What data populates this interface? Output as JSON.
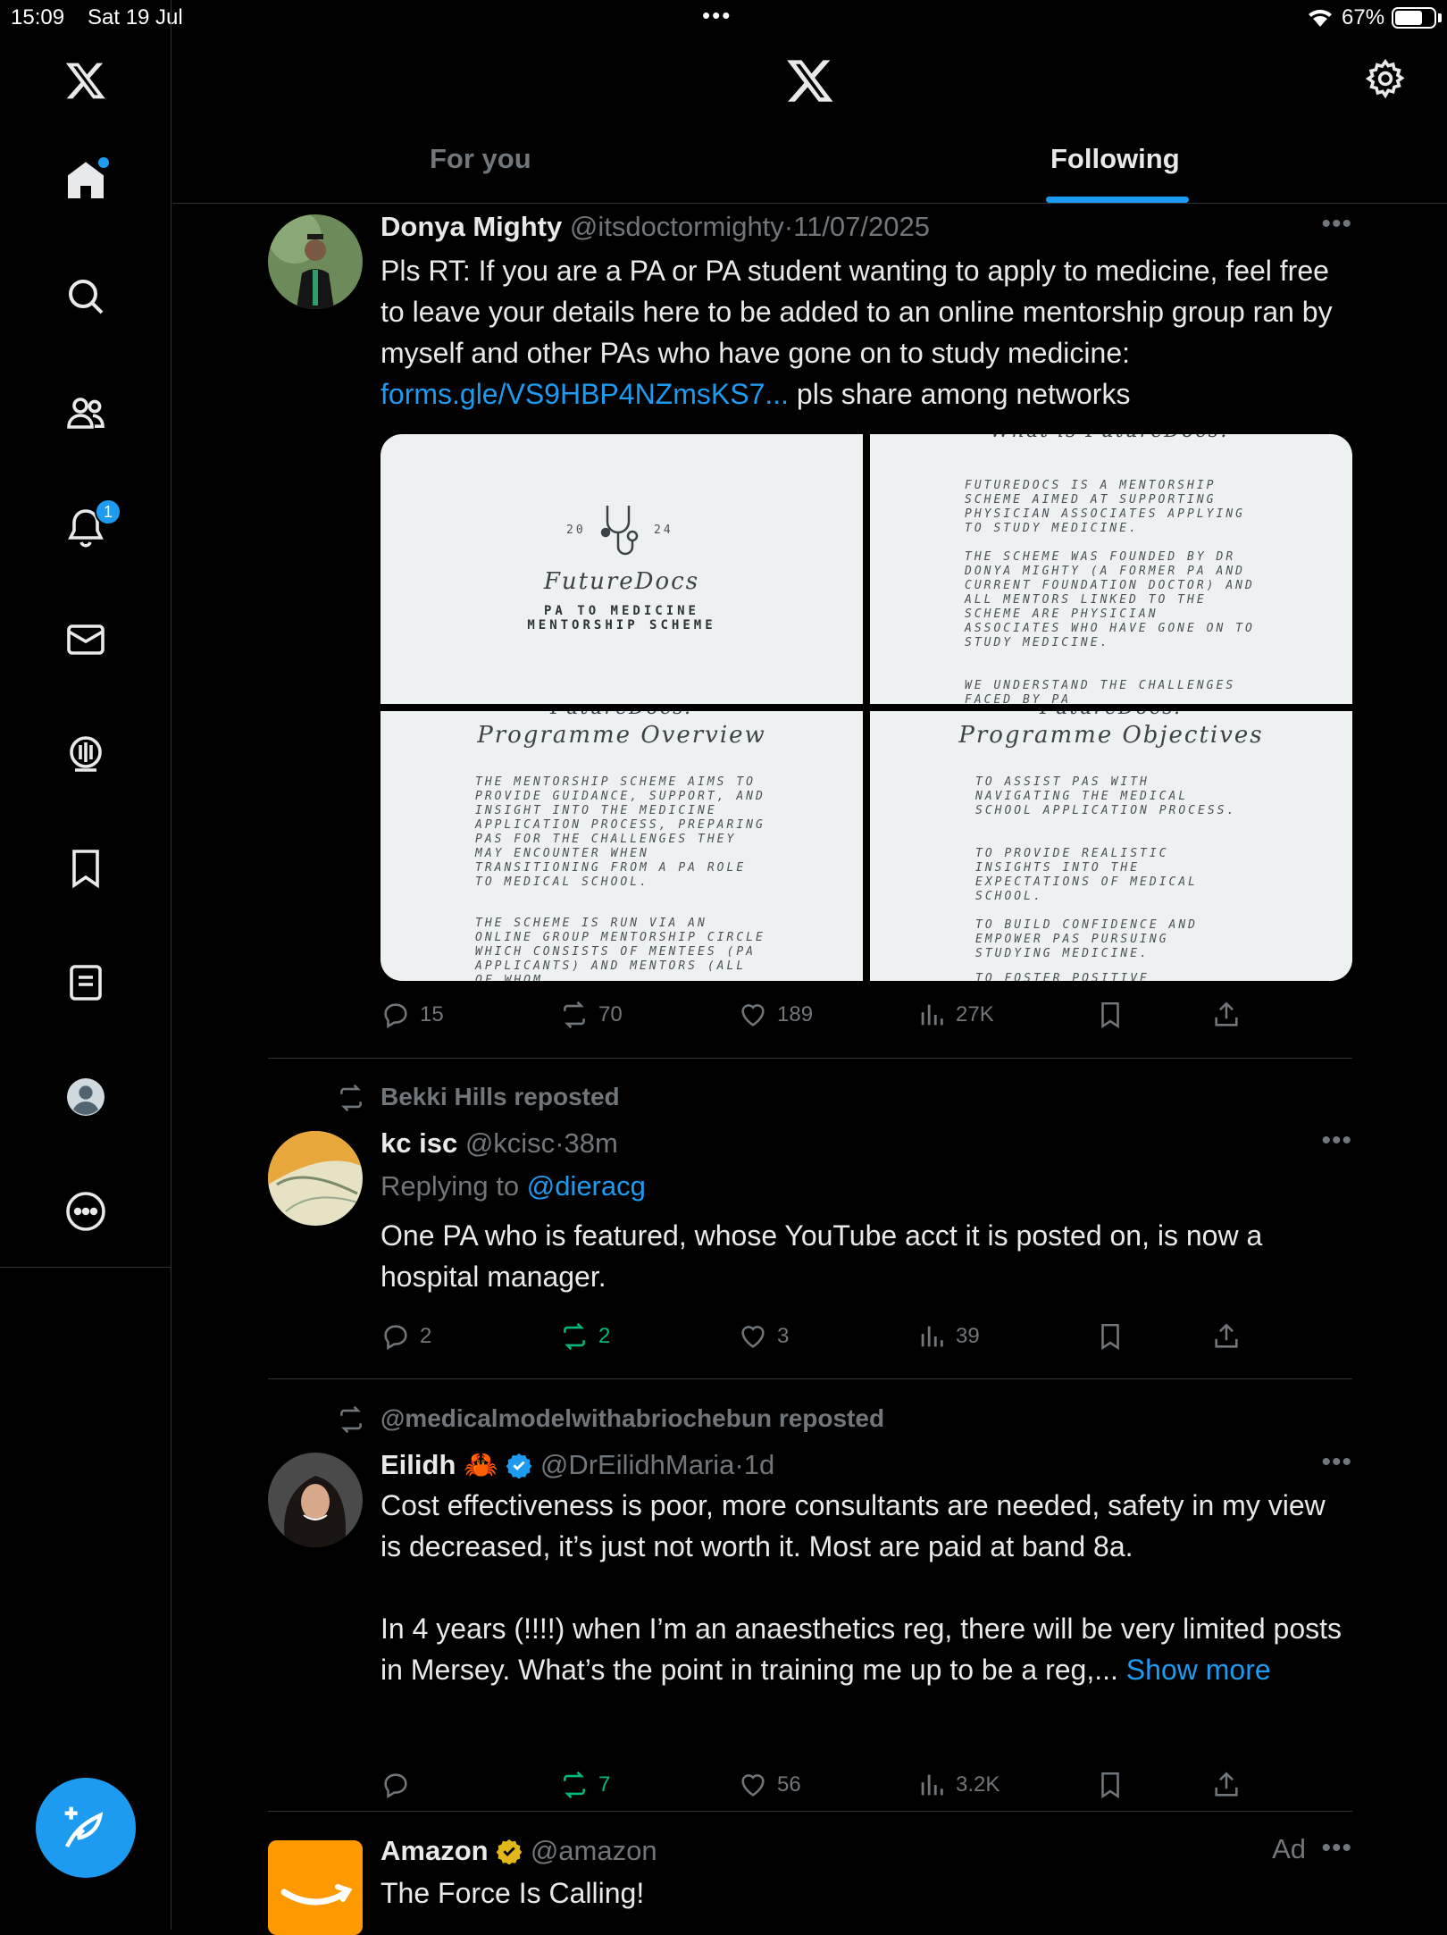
{
  "status_bar": {
    "time": "15:09",
    "date": "Sat 19 Jul",
    "battery": "67%"
  },
  "header": {
    "tabs": {
      "for_you": "For you",
      "following": "Following"
    }
  },
  "sidebar": {
    "notifications_count": "1"
  },
  "tweets": [
    {
      "name": "Donya Mighty",
      "handle": "@itsdoctormighty",
      "sep": "·",
      "time": "11/07/2025",
      "text_before_link": "Pls RT: If you are a PA or PA student wanting to apply to medicine, feel free to leave your details here to be added to an online mentorship group ran by myself and other PAs who have gone on to study medicine: ",
      "link": "forms.gle/VS9HBP4NZmsKS7...",
      "text_after_link": " pls share among networks",
      "media": {
        "p1": {
          "year_left": "20",
          "year_right": "24",
          "title": "FutureDocs",
          "sub1": "PA TO MEDICINE",
          "sub2": "MENTORSHIP SCHEME"
        },
        "p2": {
          "top": "What is FutureDocs?",
          "body1": "FUTUREDOCS IS A MENTORSHIP SCHEME AIMED AT SUPPORTING PHYSICIAN ASSOCIATES APPLYING TO STUDY MEDICINE.",
          "body2": "THE SCHEME WAS FOUNDED BY DR DONYA MIGHTY (A FORMER PA AND CURRENT FOUNDATION DOCTOR) AND ALL MENTORS LINKED TO THE SCHEME ARE PHYSICIAN ASSOCIATES WHO HAVE GONE ON TO STUDY MEDICINE.",
          "body3": "WE UNDERSTAND THE CHALLENGES FACED BY PA"
        },
        "p3": {
          "top": "FutureDocs:",
          "title": "Programme Overview",
          "body1": "THE MENTORSHIP SCHEME AIMS TO PROVIDE GUIDANCE, SUPPORT, AND INSIGHT INTO THE MEDICINE APPLICATION PROCESS, PREPARING PAS FOR THE CHALLENGES THEY MAY ENCOUNTER WHEN TRANSITIONING FROM A PA ROLE TO MEDICAL SCHOOL.",
          "body2": "THE SCHEME IS RUN VIA AN ONLINE GROUP MENTORSHIP CIRCLE WHICH CONSISTS OF MENTEES (PA APPLICANTS) AND MENTORS (ALL OF WHOM"
        },
        "p4": {
          "top": "FutureDocs:",
          "title": "Programme Objectives",
          "b1": "TO ASSIST PAS WITH NAVIGATING THE MEDICAL SCHOOL APPLICATION PROCESS.",
          "b2": "TO PROVIDE REALISTIC INSIGHTS INTO THE EXPECTATIONS OF MEDICAL SCHOOL.",
          "b3": "TO BUILD CONFIDENCE AND EMPOWER PAS PURSUING STUDYING MEDICINE.",
          "b4": "TO FOSTER POSITIVE"
        }
      },
      "replies": "15",
      "reposts": "70",
      "likes": "189",
      "views": "27K"
    },
    {
      "reposted_by": "Bekki Hills reposted",
      "name": "kc isc",
      "handle": "@kcisc",
      "sep": "·",
      "time": "38m",
      "replying_prefix": "Replying to ",
      "replying_to": "@dieracg",
      "text": "One PA who is featured, whose YouTube acct it is posted on, is now a hospital manager.",
      "replies": "2",
      "reposts": "2",
      "likes": "3",
      "views": "39"
    },
    {
      "reposted_by": "@medicalmodelwithabriochebun reposted",
      "name": "Eilidh",
      "name_emoji": "🦀",
      "handle": "@DrEilidhMaria",
      "sep": "·",
      "time": "1d",
      "text1": "Cost effectiveness is poor, more consultants are needed, safety in my view is decreased, it’s just not worth it. Most are paid at band 8a.",
      "text2": "In 4 years (!!!!) when I’m an anaesthetics reg, there will be very limited posts in Mersey. What’s the point in training me up to be a reg,... ",
      "show_more": "Show more",
      "replies": "",
      "reposts": "7",
      "likes": "56",
      "views": "3.2K"
    },
    {
      "name": "Amazon",
      "handle": "@amazon",
      "ad_label": "Ad",
      "text": "The Force Is Calling!"
    }
  ],
  "colors": {
    "accent": "#1d9bf0",
    "repost_active": "#00ba7c",
    "muted": "#71767b",
    "background": "#000000"
  }
}
